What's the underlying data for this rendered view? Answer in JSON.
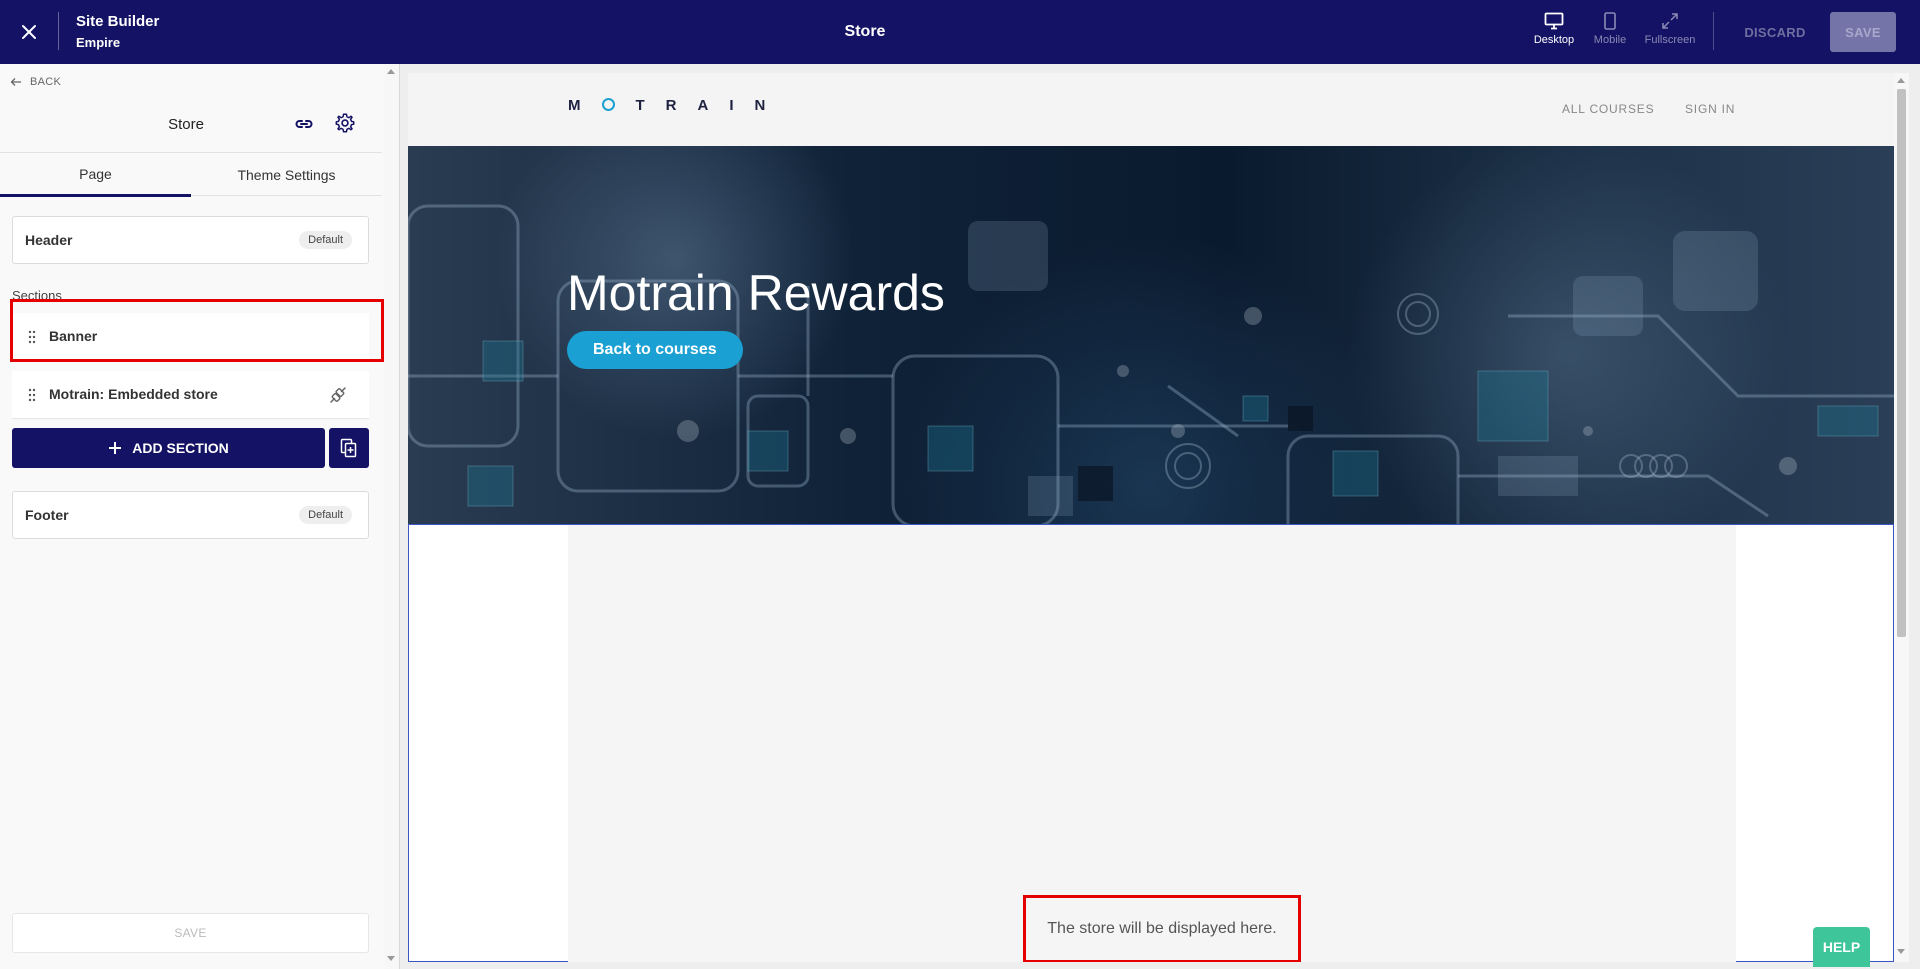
{
  "topbar": {
    "app_title": "Site Builder",
    "app_subtitle": "Empire",
    "page_name": "Store",
    "views": [
      {
        "label": "Desktop",
        "icon": "desktop-icon",
        "active": true
      },
      {
        "label": "Mobile",
        "icon": "mobile-icon",
        "active": false
      },
      {
        "label": "Fullscreen",
        "icon": "fullscreen-icon",
        "active": false
      }
    ],
    "discard_label": "DISCARD",
    "save_label": "SAVE"
  },
  "sidebar": {
    "back_label": "BACK",
    "title": "Store",
    "tabs": [
      {
        "label": "Page",
        "active": true
      },
      {
        "label": "Theme Settings",
        "active": false
      }
    ],
    "header_card": {
      "label": "Header",
      "badge": "Default"
    },
    "sections_heading": "Sections",
    "sections": [
      {
        "label": "Banner"
      },
      {
        "label": "Motrain: Embedded store",
        "icon": "plug-icon"
      }
    ],
    "add_section_label": "ADD SECTION",
    "footer_card": {
      "label": "Footer",
      "badge": "Default"
    },
    "save_label": "SAVE"
  },
  "preview": {
    "logo_text": "MOTRAIN",
    "nav": [
      "ALL COURSES",
      "SIGN IN"
    ],
    "hero_title": "Motrain Rewards",
    "hero_button": "Back to courses",
    "store_placeholder": "The store will be displayed here."
  },
  "help_label": "HELP",
  "colors": {
    "topbar_bg": "#141264",
    "accent_blue": "#1aa0d2",
    "highlight_red": "#e40000",
    "help_green": "#3ec59a"
  }
}
